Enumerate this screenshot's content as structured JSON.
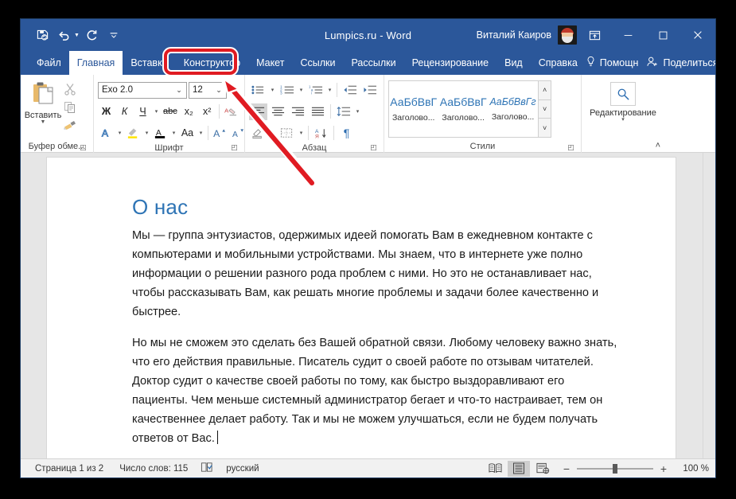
{
  "window": {
    "title": "Lumpics.ru  -  Word",
    "account_name": "Виталий Каиров",
    "avatar_name": "user-avatar"
  },
  "quick_access": [
    {
      "name": "save-icon",
      "label": "Сохранить"
    },
    {
      "name": "undo-icon",
      "label": "Отменить"
    },
    {
      "name": "redo-icon",
      "label": "Вернуть"
    },
    {
      "name": "customize-qat-icon",
      "label": "Настройка панели быстрого доступа"
    }
  ],
  "window_buttons": {
    "ribbon_display": "Параметры отображения ленты",
    "minimize": "Свернуть",
    "maximize": "Развернуть",
    "close": "Закрыть"
  },
  "tabs": [
    {
      "label": "Файл",
      "active": false
    },
    {
      "label": "Главная",
      "active": true
    },
    {
      "label": "Вставка",
      "active": false
    },
    {
      "label": "Конструктор",
      "active": false,
      "highlighted": true
    },
    {
      "label": "Макет",
      "active": false
    },
    {
      "label": "Ссылки",
      "active": false
    },
    {
      "label": "Рассылки",
      "active": false
    },
    {
      "label": "Рецензирование",
      "active": false
    },
    {
      "label": "Вид",
      "active": false
    },
    {
      "label": "Справка",
      "active": false
    }
  ],
  "tab_tools": {
    "tellme_label": "Помощн",
    "share_label": "Поделиться"
  },
  "ribbon": {
    "clipboard": {
      "group_label": "Буфер обме...",
      "paste_label": "Вставить",
      "cut_label": "Вырезать",
      "copy_label": "Копировать",
      "format_painter_label": "Формат по образцу",
      "launcher_label": "Буфер обмена"
    },
    "font": {
      "group_label": "Шрифт",
      "font_name": "Exo 2.0",
      "font_size": "12",
      "bold": "Ж",
      "italic": "К",
      "underline": "Ч",
      "strikethrough": "abc",
      "subscript": "x₂",
      "superscript": "x²",
      "clear_format_label": "Очистить формат",
      "text_effects_label": "A",
      "highlight_label": "Цвет выделения текста",
      "font_color_label": "A",
      "change_case_label": "Aa",
      "grow_font_label": "A",
      "shrink_font_label": "A",
      "launcher_label": "Шрифт"
    },
    "paragraph": {
      "group_label": "Абзац",
      "bullets_label": "Маркеры",
      "numbering_label": "Нумерация",
      "multilevel_label": "Многоуровневый список",
      "decrease_indent_label": "Уменьшить отступ",
      "increase_indent_label": "Увеличить отступ",
      "align_left_label": "По левому краю",
      "align_center_label": "По центру",
      "align_right_label": "По правому краю",
      "align_justify_label": "По ширине",
      "line_spacing_label": "Интервал",
      "shading_label": "Заливка",
      "borders_label": "Границы",
      "sort_label": "Сортировка",
      "marks_label": "¶",
      "launcher_label": "Абзац"
    },
    "styles": {
      "group_label": "Стили",
      "items": [
        {
          "preview": "АаБбВвГ",
          "name": "Заголово..."
        },
        {
          "preview": "АаБбВвГ",
          "name": "Заголово..."
        },
        {
          "preview": "АаБбВвГг",
          "name": "Заголово..."
        }
      ],
      "scroll_up": "˄",
      "scroll_down": "˅",
      "more": "˅",
      "launcher_label": "Стили"
    },
    "editing": {
      "group_label": "Редактирование",
      "find_icon": "search-icon",
      "caret": "▾"
    },
    "collapse_label": "˄"
  },
  "document": {
    "heading": "О нас",
    "paragraphs": [
      "Мы — группа энтузиастов, одержимых идеей помогать Вам в ежедневном контакте с компьютерами и мобильными устройствами. Мы знаем, что в интернете уже полно информации о решении разного рода проблем с ними. Но это не останавливает нас, чтобы рассказывать Вам, как решать многие проблемы и задачи более качественно и быстрее.",
      "Но мы не сможем это сделать без Вашей обратной связи. Любому человеку важно знать, что его действия правильные. Писатель судит о своей работе по отзывам читателей. Доктор судит о качестве своей работы по тому, как быстро выздоравливают его пациенты. Чем меньше системный администратор бегает и что-то настраивает, тем он качественнее делает работу. Так и мы не можем улучшаться, если не будем получать ответов от Вас."
    ]
  },
  "status_bar": {
    "page": "Страница 1 из 2",
    "words": "Число слов: 115",
    "proofing_icon": "proofing-icon",
    "language": "русский",
    "views": [
      {
        "name": "read-mode-icon",
        "label": "Режим чтения",
        "selected": false
      },
      {
        "name": "print-layout-icon",
        "label": "Разметка страницы",
        "selected": true
      },
      {
        "name": "web-layout-icon",
        "label": "Веб-документ",
        "selected": false
      }
    ],
    "zoom_out": "−",
    "zoom_in": "+",
    "zoom_value": "100 %"
  },
  "annotation": {
    "highlight_target": "Конструктор",
    "color": "#e01b22"
  },
  "colors": {
    "word_blue": "#2b579a",
    "heading_blue": "#2e74b5",
    "annotation_red": "#e01b22"
  }
}
